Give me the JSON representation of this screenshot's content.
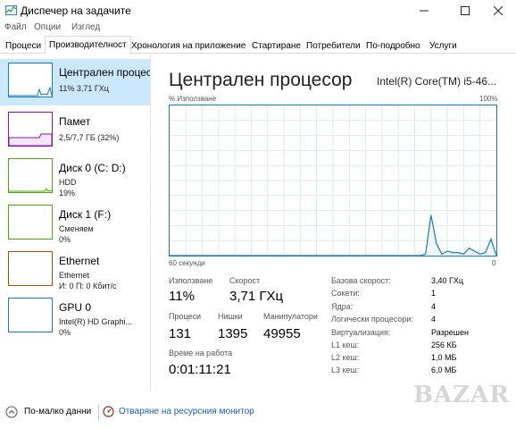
{
  "window": {
    "title": "Диспечер на задачите"
  },
  "menu": {
    "items": [
      "Файл",
      "Опции",
      "Изглед"
    ]
  },
  "tabs": [
    "Процеси",
    "Производителност",
    "Хронология на приложение",
    "Стартиране",
    "Потребители",
    "По-подробно",
    "Услуги"
  ],
  "sidebar": {
    "items": [
      {
        "name": "Централен процесор",
        "line1": "11% 3,71 ГХц",
        "color": "#117dbb"
      },
      {
        "name": "Памет",
        "line1": "2,5/7,7 ГБ (32%)",
        "color": "#8b12ae"
      },
      {
        "name": "Диск 0 (C: D:)",
        "line1": "HDD",
        "line2": "19%",
        "color": "#4da60c"
      },
      {
        "name": "Диск 1 (F:)",
        "line1": "Сменяем",
        "line2": "0%",
        "color": "#4da60c"
      },
      {
        "name": "Ethernet",
        "line1": "Ethernet",
        "line2": "И: 0 П: 0 Кбит/с",
        "color": "#a74f01"
      },
      {
        "name": "GPU 0",
        "line1": "Intel(R) HD Graphi...",
        "line2": "0%",
        "color": "#117dbb"
      }
    ]
  },
  "main": {
    "title": "Централен процесор",
    "model": "Intel(R) Core(TM) i5-46...",
    "graph": {
      "ylabel": "% Използване",
      "ymax_label": "100%",
      "xlabel": "60 секунди",
      "xmin_label": "0",
      "line_color": "#117dbb",
      "grid_color": "#d9eaf7",
      "series": [
        0,
        0,
        0,
        0,
        0,
        0,
        0,
        0,
        0,
        0,
        0,
        0,
        0,
        0,
        0,
        0,
        0,
        0,
        0,
        0,
        0,
        0,
        0,
        0,
        0,
        0,
        0,
        0,
        0,
        0,
        0,
        0,
        0,
        0,
        0,
        0,
        0,
        0,
        0,
        0,
        0,
        0,
        0,
        0,
        0,
        0,
        0,
        1,
        27,
        8,
        1,
        3,
        2,
        2,
        1,
        5,
        3,
        1,
        2,
        11,
        0
      ]
    },
    "stats": {
      "utilization_label": "Използване",
      "utilization": "11%",
      "speed_label": "Скорост",
      "speed": "3,71 ГХц",
      "processes_label": "Процеси",
      "processes": "131",
      "threads_label": "Нишки",
      "threads": "1395",
      "handles_label": "Манипулатори",
      "handles": "49955",
      "uptime_label": "Време на работа",
      "uptime": "0:01:11:21"
    },
    "info": [
      {
        "label": "Базова скорост:",
        "value": "3,40 ГХц"
      },
      {
        "label": "Сокети:",
        "value": "1"
      },
      {
        "label": "Ядра:",
        "value": "4"
      },
      {
        "label": "Логически процесори:",
        "value": "4"
      },
      {
        "label": "Виртуализация:",
        "value": "Разрешен"
      },
      {
        "label": "L1 кеш:",
        "value": "256 КБ"
      },
      {
        "label": "L2 кеш:",
        "value": "1,0 МБ"
      },
      {
        "label": "L3 кеш:",
        "value": "6,0 МБ"
      }
    ]
  },
  "footer": {
    "fewer_details": "По-малко данни",
    "resource_monitor": "Отваряне на ресурсния монитор"
  },
  "watermark": "BAZAR"
}
